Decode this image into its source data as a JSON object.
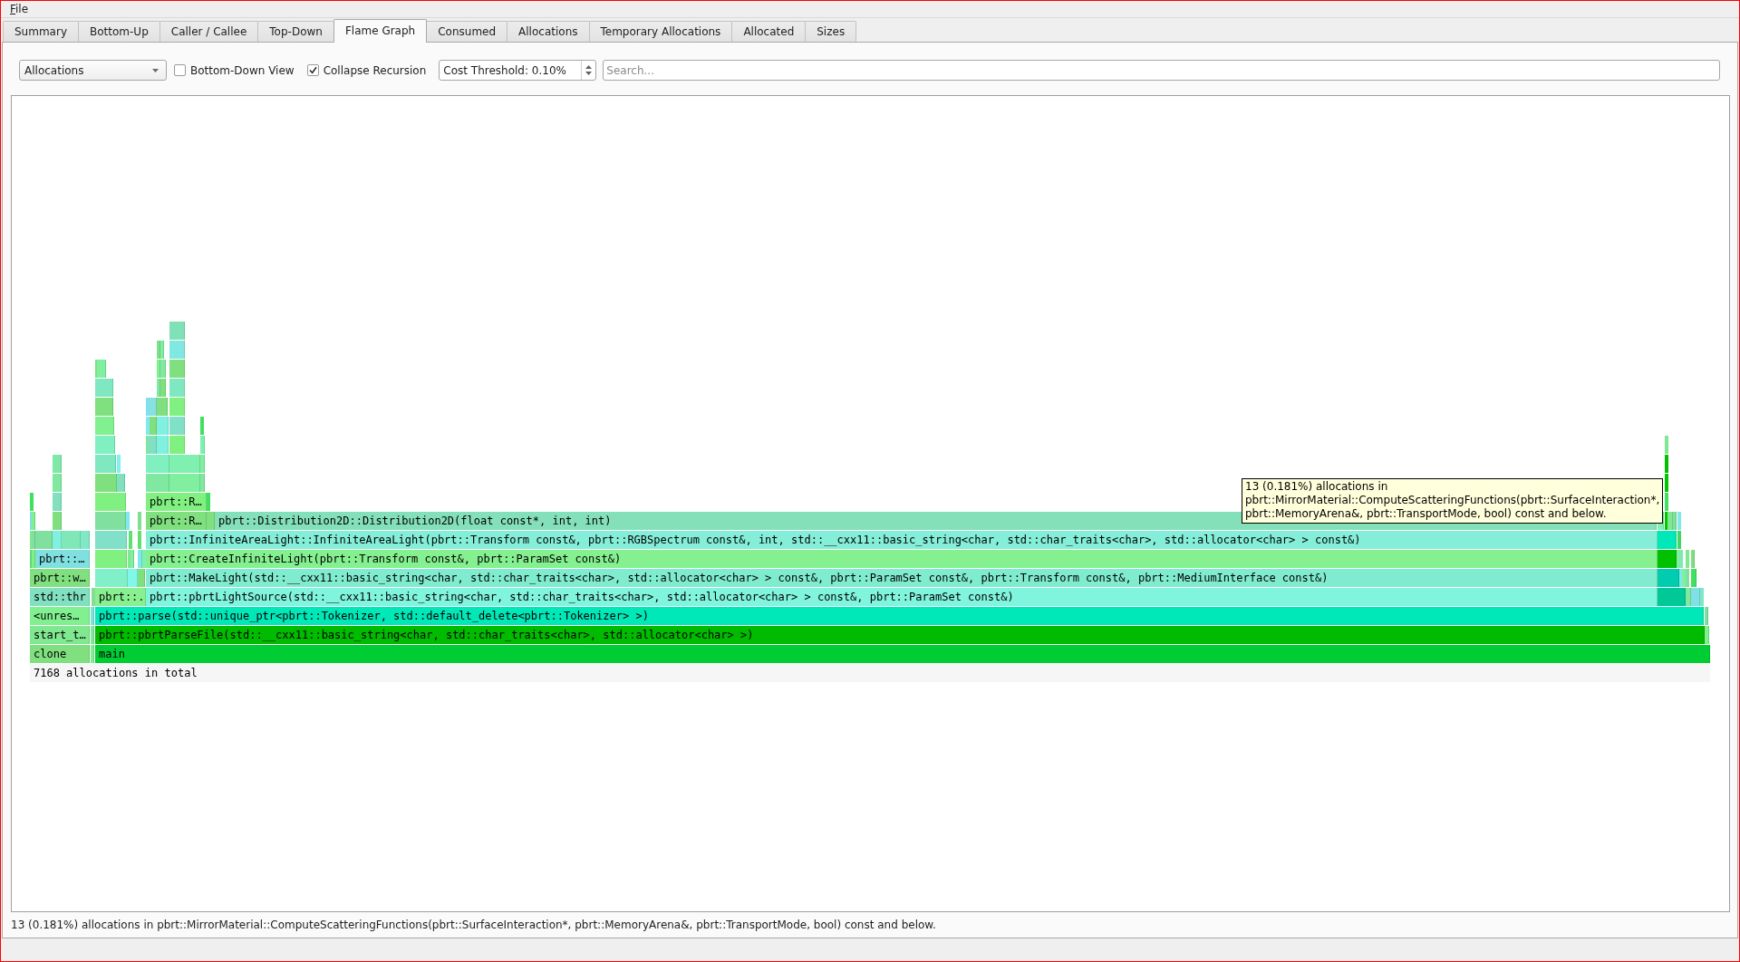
{
  "menu_bar": {
    "items": [
      "File"
    ]
  },
  "tabs": [
    {
      "label": "Summary",
      "selected": false
    },
    {
      "label": "Bottom-Up",
      "selected": false
    },
    {
      "label": "Caller / Callee",
      "selected": false
    },
    {
      "label": "Top-Down",
      "selected": false
    },
    {
      "label": "Flame Graph",
      "selected": true
    },
    {
      "label": "Consumed",
      "selected": false
    },
    {
      "label": "Allocations",
      "selected": false
    },
    {
      "label": "Temporary Allocations",
      "selected": false
    },
    {
      "label": "Allocated",
      "selected": false
    },
    {
      "label": "Sizes",
      "selected": false
    }
  ],
  "toolbar": {
    "cost_type": {
      "value": "Allocations"
    },
    "options": [
      {
        "label": "Bottom-Down View",
        "checked": false
      },
      {
        "label": "Collapse Recursion",
        "checked": true
      }
    ],
    "cost_threshold": {
      "value": "Cost Threshold: 0.10%"
    },
    "search": {
      "placeholder": "Search..."
    }
  },
  "flame_graph": {
    "frames": [
      {
        "label": "clone",
        "color": "#80e080",
        "children": [
          {
            "label": "start_t…",
            "color": "#80e890",
            "children": [
              {
                "label": "<unres…",
                "color": "#80f090",
                "children": [
                  {
                    "label": "std::thr",
                    "color": "#80e0c0",
                    "children": [
                      {
                        "label": "pbrt::w…",
                        "color": "#80e080",
                        "children": [
                          {
                            "color": "#60d880",
                            "children": [
                              {
                                "color": "#80e890",
                                "children": [
                                  {
                                    "color": "#80e0e0",
                                    "children": [
                                      {
                                        "color": "#40e060"
                                      }
                                    ]
                                  }
                                ]
                              }
                            ]
                          },
                          {
                            "color": "#80f080",
                            "children": [
                              {
                                "color": "#80e0a0",
                                "children": [
                                  {
                                    "color": "#80f090"
                                  }
                                ]
                              }
                            ]
                          },
                          {
                            "label": "pbrt::…",
                            "color": "#80e0e0",
                            "children": [
                              {
                                "color": "#80e0a0"
                              },
                              {
                                "color": "#80f0e0",
                                "children": [
                                  {
                                    "color": "#80e080",
                                    "children": [
                                      {
                                        "color": "#80e0c0",
                                        "children": [
                                          {
                                            "color": "#80e8a0",
                                            "children": [
                                              {
                                                "color": "#80e8a8"
                                              }
                                            ]
                                          }
                                        ]
                                      }
                                    ]
                                  }
                                ]
                              },
                              {
                                "color": "#80e8b8"
                              },
                              {
                                "color": "#80e8c8"
                              }
                            ]
                          }
                        ]
                      }
                    ]
                  }
                ]
              }
            ]
          }
        ]
      },
      {
        "color": "#80f090",
        "children": [
          {
            "color": "#80e8a0",
            "children": [
              {
                "color": "#80e0e0",
                "children": [
                  {
                    "color": "#80e090"
                  }
                ]
              }
            ]
          }
        ]
      },
      {
        "label": "main",
        "color": "#00cc33",
        "children": [
          {
            "label": "pbrt::pbrtParseFile(std::__cxx11::basic_string<char, std::char_traits<char>, std::allocator<char> >)",
            "color": "#00bb00",
            "children": [
              {
                "label": "pbrt::parse(std::unique_ptr<pbrt::Tokenizer, std::default_delete<pbrt::Tokenizer> >)",
                "color": "#00e8b8",
                "children": [
                  {
                    "label": "pbrt::.",
                    "color": "#88f090",
                    "children": [
                      {
                        "color": "#80f0c8",
                        "children": [
                          {
                            "color": "#80f080",
                            "children": [
                              {
                                "color": "#80e0c8",
                                "children": [
                                  {
                                    "color": "#80e0a0",
                                    "children": [
                                      {
                                        "color": "#80f080",
                                        "children": [
                                          {
                                            "color": "#80e080",
                                            "children": [
                                              {
                                                "color": "#80e8c0",
                                                "children": [
                                                  {
                                                    "color": "#80f0c0",
                                                    "children": [
                                                      {
                                                        "color": "#80f090",
                                                        "children": [
                                                          {
                                                            "color": "#80e080",
                                                            "children": [
                                                              {
                                                                "color": "#80e8c0",
                                                                "children": [
                                                                  {
                                                                    "color": "#80e080"
                                                                  },
                                                                  {
                                                                    "color": "#80f0a0"
                                                                  }
                                                                ]
                                                              }
                                                            ]
                                                          }
                                                        ]
                                                      }
                                                    ]
                                                  }
                                                ]
                                              }
                                            ]
                                          },
                                          {
                                            "color": "#80e0c0",
                                            "children": [
                                              {
                                                "color": "#80f0f0"
                                              }
                                            ]
                                          }
                                        ]
                                      }
                                    ]
                                  },
                                  {
                                    "color": "#80e8f0"
                                  }
                                ]
                              }
                            ]
                          }
                        ]
                      },
                      {
                        "color": "#80f8e8",
                        "children": [
                          {
                            "color": "#80e890",
                            "children": [
                              {
                                "color": "#60e070"
                              }
                            ]
                          },
                          {
                            "color": "#80f0a0"
                          }
                        ]
                      },
                      {
                        "color": "#80e080",
                        "children": [
                          {
                            "color": "#80e8e8",
                            "children": [
                              {
                                "color": "#60e070",
                                "children": [
                                  {
                                    "color": "#80e090"
                                  }
                                ]
                              }
                            ]
                          },
                          {
                            "color": "#80f0b0"
                          }
                        ]
                      }
                    ]
                  },
                  {
                    "label": "pbrt::pbrtLightSource(std::__cxx11::basic_string<char, std::char_traits<char>, std::allocator<char> > const&, pbrt::ParamSet const&)",
                    "color": "#80f4dc",
                    "children": [
                      {
                        "label": "pbrt::MakeLight(std::__cxx11::basic_string<char, std::char_traits<char>, std::allocator<char> > const&, pbrt::ParamSet const&, pbrt::Transform const&, pbrt::MediumInterface const&)",
                        "color": "#80eccf",
                        "children": [
                          {
                            "label": "pbrt::CreateInfiniteLight(pbrt::Transform const&, pbrt::ParamSet const&)",
                            "color": "#84f090",
                            "children": [
                              {
                                "label": "pbrt::InfiniteAreaLight::InfiniteAreaLight(pbrt::Transform const&, pbrt::RGBSpectrum const&, int, std::__cxx11::basic_string<char, std::char_traits<char>, std::allocator<char> > const&)",
                                "color": "#84eed8",
                                "children": [
                                  {
                                    "label": "pbrt::R…",
                                    "color": "#80e080",
                                    "children": [
                                      {
                                        "label": "pbrt::R…",
                                        "color": "#80f080",
                                        "children": [
                                          {
                                            "color": "#80e8a0",
                                            "children": [
                                              {
                                                "color": "#80f0c0",
                                                "children": [
                                                  {
                                                    "color": "#80e890",
                                                    "children": [
                                                      {
                                                        "color": "#80e8f0",
                                                        "children": [
                                                          {
                                                            "color": "#80e0f0"
                                                          }
                                                        ]
                                                      }
                                                    ]
                                                  },
                                                  {
                                                    "color": "#80e0c0",
                                                    "children": [
                                                      {
                                                        "color": "#80e080",
                                                        "children": [
                                                          {
                                                            "color": "#88e0e0"
                                                          }
                                                        ]
                                                      }
                                                    ]
                                                  },
                                                  {
                                                    "color": "#80f0e0",
                                                    "children": [
                                                      {
                                                        "color": "#80f0e0",
                                                        "children": [
                                                          {
                                                            "color": "#80e080",
                                                            "children": [
                                                              {
                                                                "color": "#80e8a0",
                                                                "children": [
                                                                  {
                                                                    "color": "#80f090",
                                                                    "children": [
                                                                      {
                                                                        "color": "#80e090"
                                                                      }
                                                                    ]
                                                                  }
                                                                ]
                                                              },
                                                              {
                                                                "color": "#80e080",
                                                                "children": [
                                                                  {
                                                                    "color": "#80e8a0",
                                                                    "children": [
                                                                      {
                                                                        "color": "#80f0a0"
                                                                      }
                                                                    ]
                                                                  }
                                                                ]
                                                              }
                                                            ]
                                                          }
                                                        ]
                                                      }
                                                    ]
                                                  }
                                                ]
                                              }
                                            ]
                                          },
                                          {
                                            "color": "#80f0a0",
                                            "children": [
                                              {
                                                "color": "#80f0b0",
                                                "children": [
                                                  {
                                                    "color": "#80f080",
                                                    "children": [
                                                      {
                                                        "color": "#80e0c8",
                                                        "children": [
                                                          {
                                                            "color": "#80f080",
                                                            "children": [
                                                              {
                                                                "color": "#80e8c0",
                                                                "children": [
                                                                  {
                                                                    "color": "#80e080",
                                                                    "children": [
                                                                      {
                                                                        "color": "#80e8e0",
                                                                        "children": [
                                                                          {
                                                                            "color": "#80e0b8"
                                                                          }
                                                                        ]
                                                                      }
                                                                    ]
                                                                  }
                                                                ]
                                                              }
                                                            ]
                                                          }
                                                        ]
                                                      }
                                                    ]
                                                  }
                                                ]
                                              }
                                            ]
                                          },
                                          {
                                            "color": "#80e8a0",
                                            "children": [
                                              {
                                                "color": "#80f0a0",
                                                "children": [
                                                  {
                                                    "color": "#80f0b0",
                                                    "children": [
                                                      {
                                                        "color": "#40e060"
                                                      }
                                                    ]
                                                  }
                                                ]
                                              }
                                            ]
                                          }
                                        ]
                                      }
                                    ]
                                  },
                                  {
                                    "color": "#80e080",
                                    "children": [
                                      {
                                        "color": "#40e060"
                                      }
                                    ]
                                  },
                                  {
                                    "label": "pbrt::Distribution2D::Distribution2D(float const*, int, int)",
                                    "color": "#84e0b8"
                                  }
                                ]
                              }
                            ]
                          }
                        ]
                      }
                    ]
                  },
                  {
                    "color": "#00c896",
                    "children": [
                      {
                        "color": "#00ccb0",
                        "children": [
                          {
                            "color": "#00c000",
                            "children": [
                              {
                                "color": "#00e8b8",
                                "children": [
                                  {
                                    "color": "#80f0b0"
                                  },
                                  {
                                    "color": "#00c800",
                                    "children": [
                                      {
                                        "color": "#40e060",
                                        "children": [
                                          {
                                            "color": "#00c800",
                                            "children": [
                                              {
                                                "color": "#00c000",
                                                "children": [
                                                  {
                                                    "color": "#80e890"
                                                  }
                                                ]
                                              }
                                            ]
                                          }
                                        ]
                                      }
                                    ]
                                  },
                                  {
                                    "color": "#80e890"
                                  },
                                  {
                                    "color": "#80e0a0"
                                  }
                                ]
                              }
                            ]
                          },
                          {
                            "color": "#80f0a0",
                            "children": [
                              {
                                "color": "#40d860",
                                "children": [
                                  {
                                    "color": "#80e8e8"
                                  }
                                ]
                              }
                            ]
                          }
                        ]
                      },
                      {
                        "color": "#80e8e8",
                        "children": [
                          {
                            "color": "#80e8b0"
                          }
                        ]
                      },
                      {
                        "color": "#80f0a0"
                      }
                    ]
                  },
                  {
                    "color": "#80e8a0",
                    "children": [
                      {
                        "color": "#80e0a0",
                        "children": [
                          {
                            "color": "#80e890"
                          }
                        ]
                      }
                    ]
                  },
                  {
                    "color": "#80e0e8",
                    "children": [
                      {
                        "color": "#40e060",
                        "children": [
                          {
                            "color": "#80e080"
                          }
                        ]
                      }
                    ]
                  },
                  {
                    "color": "#80e8c8"
                  }
                ]
              }
            ]
          },
          {
            "color": "#80f090",
            "children": [
              {
                "color": "#80e0a0"
              }
            ]
          }
        ]
      }
    ],
    "total": "7168 allocations in total",
    "tooltip": "13 (0.181%) allocations in pbrt::MirrorMaterial::ComputeScatteringFunctions(pbrt::SurfaceInteraction*, pbrt::MemoryArena&, pbrt::TransportMode, bool) const and below."
  },
  "status_bar": {
    "text": "13 (0.181%) allocations in pbrt::MirrorMaterial::ComputeScatteringFunctions(pbrt::SurfaceInteraction*, pbrt::MemoryArena&, pbrt::TransportMode, bool) const and below."
  }
}
